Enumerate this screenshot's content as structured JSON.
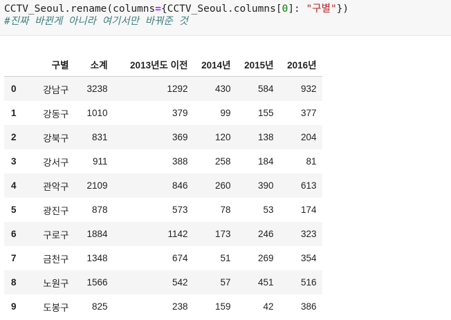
{
  "code": {
    "line1": {
      "prefix": "CCTV_Seoul.rename(columns",
      "op": "=",
      "middle1": "{CCTV_Seoul.columns[",
      "num": "0",
      "middle2": "]: ",
      "str": "\"구별\"",
      "suffix": "})"
    },
    "comment": "#진짜 바뀐게 아니라 여기서만 바꿔준 것"
  },
  "table": {
    "header": [
      "",
      "구별",
      "소계",
      "2013년도 이전",
      "2014년",
      "2015년",
      "2016년"
    ],
    "rows": [
      [
        "0",
        "강남구",
        "3238",
        "1292",
        "430",
        "584",
        "932"
      ],
      [
        "1",
        "강동구",
        "1010",
        "379",
        "99",
        "155",
        "377"
      ],
      [
        "2",
        "강북구",
        "831",
        "369",
        "120",
        "138",
        "204"
      ],
      [
        "3",
        "강서구",
        "911",
        "388",
        "258",
        "184",
        "81"
      ],
      [
        "4",
        "관악구",
        "2109",
        "846",
        "260",
        "390",
        "613"
      ],
      [
        "5",
        "광진구",
        "878",
        "573",
        "78",
        "53",
        "174"
      ],
      [
        "6",
        "구로구",
        "1884",
        "1142",
        "173",
        "246",
        "323"
      ],
      [
        "7",
        "금천구",
        "1348",
        "674",
        "51",
        "269",
        "354"
      ],
      [
        "8",
        "노원구",
        "1566",
        "542",
        "57",
        "451",
        "516"
      ],
      [
        "9",
        "도봉구",
        "825",
        "238",
        "159",
        "42",
        "386"
      ]
    ]
  }
}
